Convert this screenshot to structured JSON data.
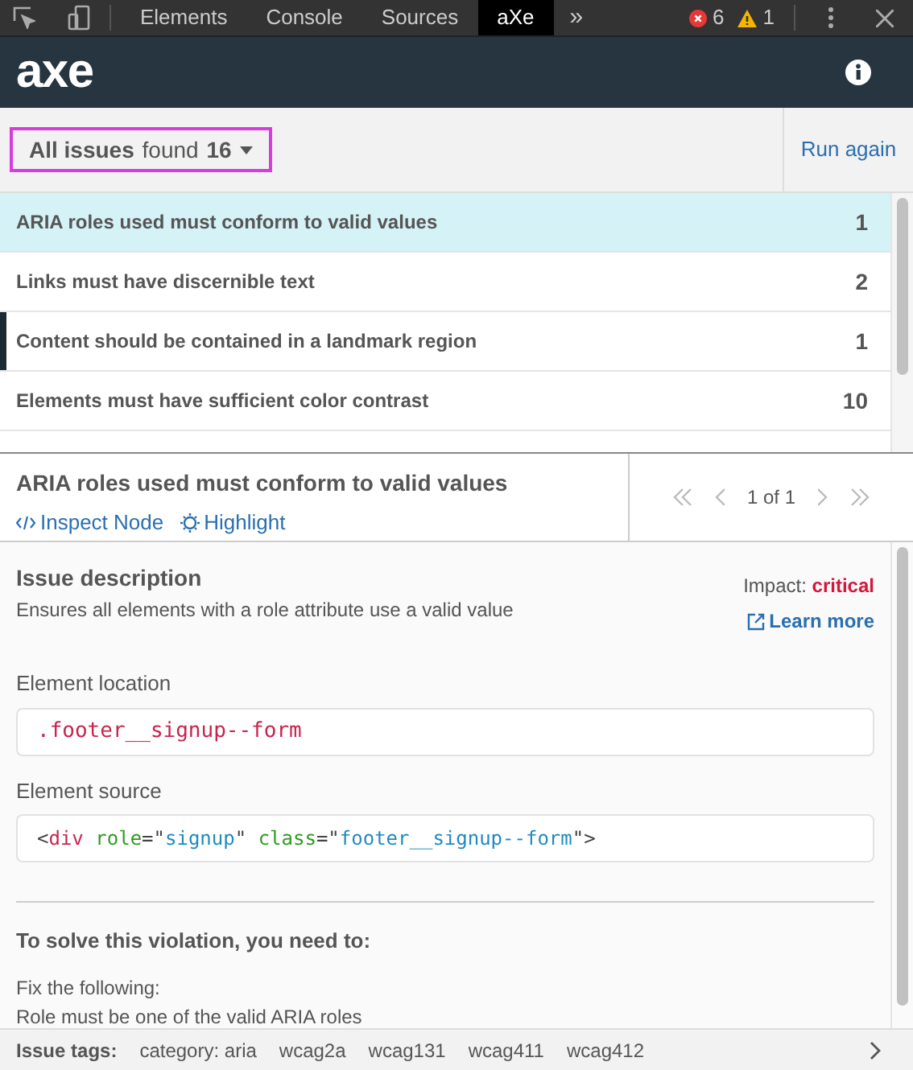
{
  "devtools": {
    "tabs": [
      {
        "label": "Elements",
        "selected": false
      },
      {
        "label": "Console",
        "selected": false
      },
      {
        "label": "Sources",
        "selected": false
      },
      {
        "label": "aXe",
        "selected": true
      }
    ],
    "more": "»",
    "errors": "6",
    "warnings": "1"
  },
  "header": {
    "logo": "axe"
  },
  "toolbar": {
    "filter": {
      "prefix": "All issues",
      "middle": " found ",
      "count": "16"
    },
    "run_again": "Run again"
  },
  "issues": [
    {
      "title": "ARIA roles used must conform to valid values",
      "count": "1",
      "selected": true,
      "focused": false
    },
    {
      "title": "Links must have discernible text",
      "count": "2",
      "selected": false,
      "focused": false
    },
    {
      "title": "Content should be contained in a landmark region",
      "count": "1",
      "selected": false,
      "focused": true
    },
    {
      "title": "Elements must have sufficient color contrast",
      "count": "10",
      "selected": false,
      "focused": false
    }
  ],
  "detail": {
    "title": "ARIA roles used must conform to valid values",
    "inspect": "Inspect Node",
    "highlight": "Highlight",
    "pager": "1 of 1",
    "description_heading": "Issue description",
    "description": "Ensures all elements with a role attribute use a valid value",
    "impact_label": "Impact:",
    "impact": "critical",
    "learn_more": "Learn more",
    "location_heading": "Element location",
    "location": ".footer__signup--form",
    "source_heading": "Element source",
    "source_tokens": [
      {
        "kind": "punct",
        "text": "<"
      },
      {
        "kind": "tag",
        "text": "div"
      },
      {
        "kind": "attr",
        "text": " role"
      },
      {
        "kind": "punct",
        "text": "=\""
      },
      {
        "kind": "string",
        "text": "signup"
      },
      {
        "kind": "punct",
        "text": "\" "
      },
      {
        "kind": "attr",
        "text": "class"
      },
      {
        "kind": "punct",
        "text": "=\""
      },
      {
        "kind": "string",
        "text": "footer__signup--form"
      },
      {
        "kind": "punct",
        "text": "\">"
      }
    ],
    "solve_heading": "To solve this violation, you need to:",
    "fix_heading": "Fix the following:",
    "fix": "Role must be one of the valid ARIA roles"
  },
  "tags": {
    "label": "Issue tags:",
    "items": [
      "category: aria",
      "wcag2a",
      "wcag131",
      "wcag411",
      "wcag412"
    ]
  }
}
